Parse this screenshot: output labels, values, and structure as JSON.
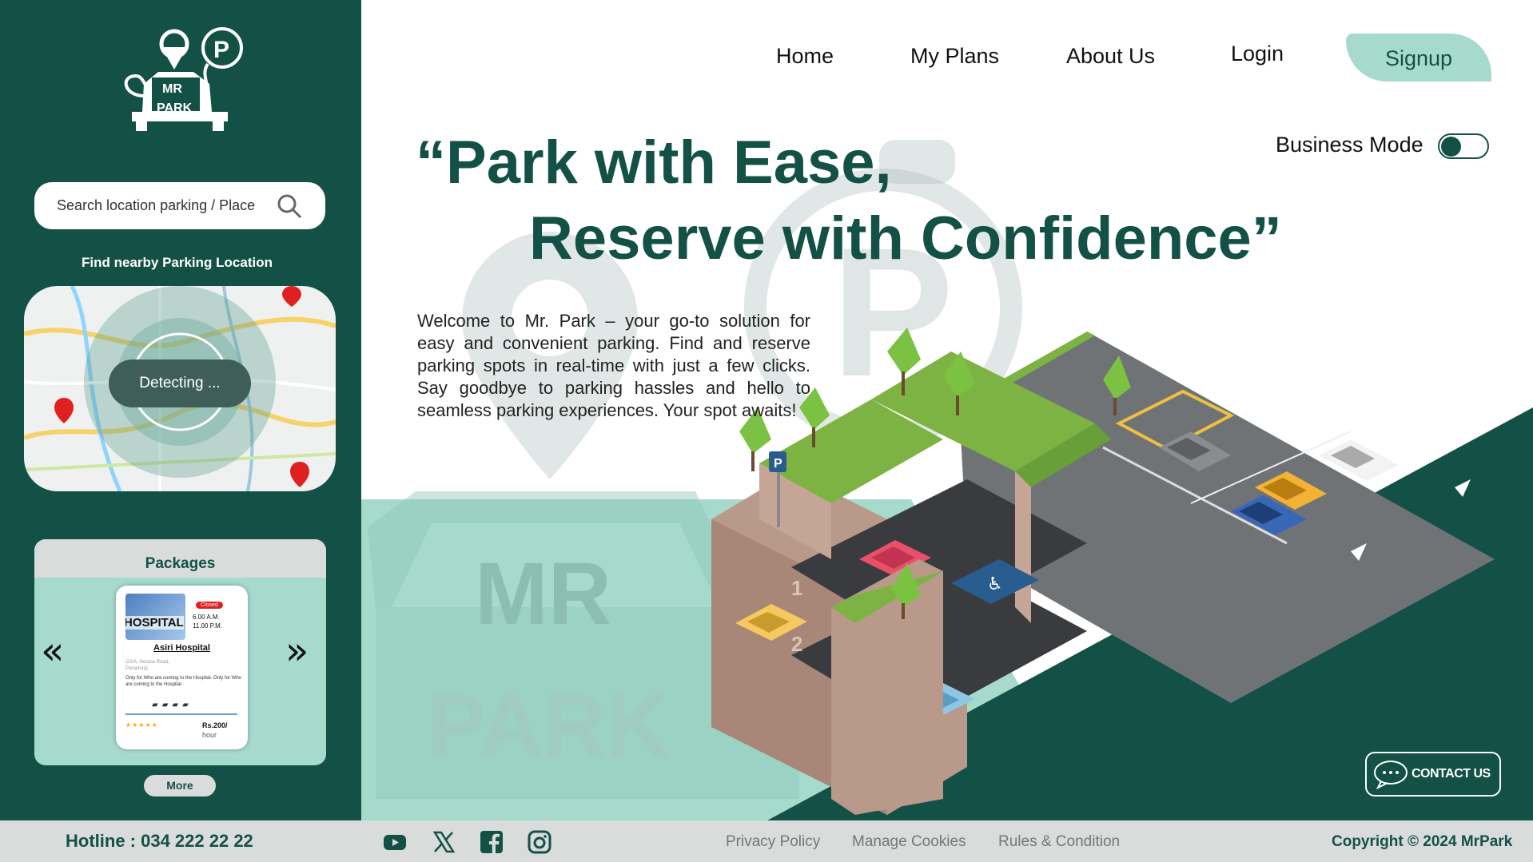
{
  "brand": {
    "logo_line1": "MR",
    "logo_line2": "PARK"
  },
  "search": {
    "placeholder": "Search location parking / Place"
  },
  "find_label": "Find nearby Parking Location",
  "map": {
    "detect_label": "Detecting ..."
  },
  "packages": {
    "title": "Packages",
    "prev_glyph": "«",
    "next_glyph": "»",
    "card": {
      "image_text": "HOSPITAL",
      "status": "Closed",
      "open_time": "6.00 A.M.",
      "close_time": "11.00 P.M.",
      "name": "Asiri Hospital",
      "address": "[23/A, Horana Road, Panadura]",
      "note": "Only for Who are coming to the Hospital. Only for Who are coming to the Hospital.",
      "rating": 4,
      "rating_stars": "★★★★★",
      "price": "Rs.200/",
      "price_unit": "hour"
    },
    "more_label": "More"
  },
  "nav": {
    "home": "Home",
    "plans": "My Plans",
    "about": "About Us",
    "login": "Login",
    "signup": "Signup"
  },
  "business_mode": {
    "label": "Business Mode",
    "enabled": false
  },
  "hero": {
    "line1": "“Park with Ease,",
    "line2": "Reserve with Confidence”"
  },
  "intro": "Welcome to Mr. Park – your go-to solution for easy and convenient parking. Find and reserve parking spots in real-time with just a few clicks. Say goodbye to parking hassles and hello to seamless parking experiences. Your spot awaits!",
  "watermark": {
    "line1": "MR",
    "line2": "PARK"
  },
  "contact_label": "CONTACT US",
  "footer": {
    "hotline": "Hotline : 034 222 22 22",
    "privacy": "Privacy Policy",
    "cookies": "Manage Cookies",
    "rules": "Rules & Condition",
    "copyright": "Copyright © 2024 MrPark"
  },
  "colors": {
    "primary": "#135146",
    "mint": "#a6dacd",
    "grey": "#d9dcdb"
  }
}
